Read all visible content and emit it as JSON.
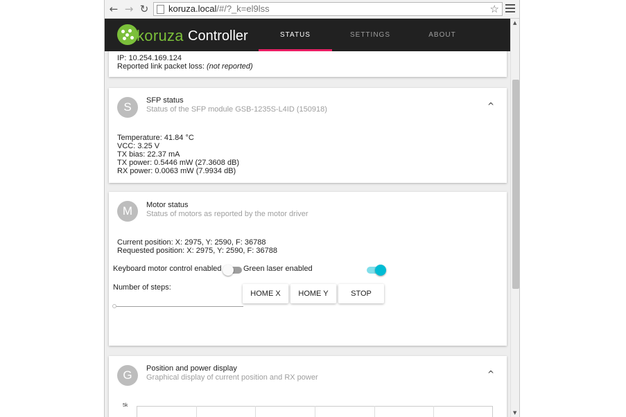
{
  "browser": {
    "url_host": "koruza.local",
    "url_path": "/#/?_k=el9lss",
    "back_icon": "←",
    "forward_icon": "→",
    "reload_icon": "↻",
    "star_icon": "☆"
  },
  "app": {
    "brand": "koruza",
    "title": "Controller",
    "tabs": [
      {
        "label": "STATUS",
        "active": true
      },
      {
        "label": "SETTINGS",
        "active": false
      },
      {
        "label": "ABOUT",
        "active": false
      }
    ],
    "accent_color": "#e91e63",
    "logo_color": "#7bbf3a"
  },
  "network": {
    "ip_line": "IP: 10.254.169.124",
    "loss_label": "Reported link packet loss:",
    "loss_value": "(not reported)"
  },
  "sfp": {
    "avatar": "S",
    "title": "SFP status",
    "subtitle": "Status of the SFP module GSB-1235S-L4ID (150918)",
    "chevron": "^",
    "lines": [
      "Temperature: 41.84 °C",
      "VCC: 3.25 V",
      "TX bias: 22.37 mA",
      "TX power: 0.5446 mW (27.3608 dB)",
      "RX power: 0.0063 mW (7.9934 dB)"
    ]
  },
  "motor": {
    "avatar": "M",
    "title": "Motor status",
    "subtitle": "Status of motors as reported by the motor driver",
    "current_position": "Current position: X: 2975, Y: 2590, F: 36788",
    "requested_position": "Requested position: X: 2975, Y: 2590, F: 36788",
    "keyboard_label": "Keyboard motor control enabled",
    "keyboard_enabled": false,
    "laser_label": "Green laser enabled",
    "laser_enabled": true,
    "steps_label": "Number of steps:",
    "buttons": {
      "home_x": "HOME X",
      "home_y": "HOME Y",
      "stop": "STOP"
    }
  },
  "graph": {
    "avatar": "G",
    "title": "Position and power display",
    "subtitle": "Graphical display of current position and RX power",
    "chevron": "^",
    "axis_top_label": "5k",
    "grid_columns": 6
  }
}
